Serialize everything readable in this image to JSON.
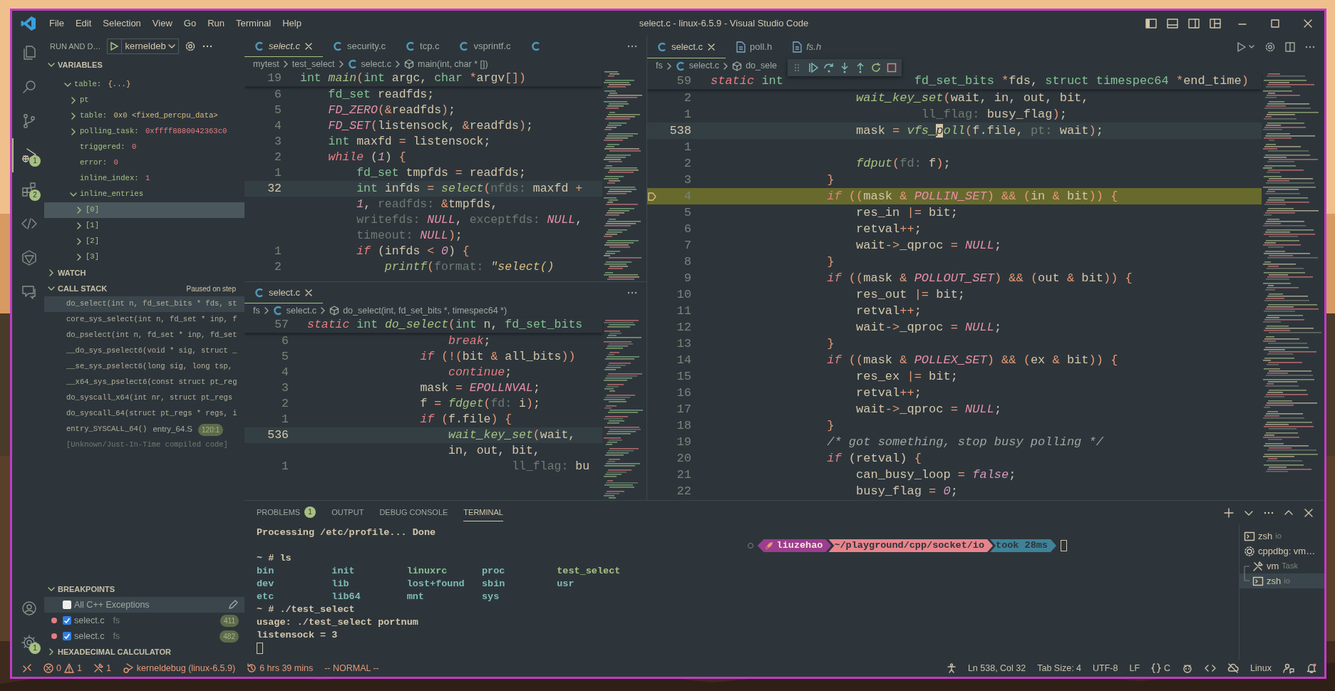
{
  "title_bar": {
    "menu": [
      "File",
      "Edit",
      "Selection",
      "View",
      "Go",
      "Run",
      "Terminal",
      "Help"
    ],
    "title": "select.c - linux-6.5.9 - Visual Studio Code"
  },
  "activity_bar": {
    "items": [
      {
        "selected": false
      },
      {
        "selected": false
      },
      {
        "selected": false
      },
      {
        "selected": true,
        "badge": "1"
      },
      {
        "selected": false,
        "badge": "2"
      },
      {
        "selected": false
      },
      {
        "selected": false
      },
      {
        "selected": false
      }
    ],
    "bottom": [
      {
        "selected": false
      },
      {
        "selected": false,
        "badge": "1"
      }
    ]
  },
  "sidebar": {
    "title": "RUN AND D…",
    "config": "kerneldeb",
    "sections": [
      {
        "kind": "variables",
        "title": "VARIABLES",
        "expanded": true,
        "tree": [
          {
            "name": "table:",
            "value": {
              "kind": "struct",
              "text": "{...}"
            },
            "kind": "group",
            "expanded": true,
            "selected": false,
            "children": [
              {
                "name": "pt",
                "kind": "group",
                "expanded": false,
                "selected": false
              },
              {
                "name": "table:",
                "value": {
                  "kind": "struct",
                  "text": "0x0 <fixed_percpu_data>"
                },
                "kind": "group",
                "expanded": false,
                "selected": false
              },
              {
                "name": "polling_task:",
                "value": {
                  "kind": "number",
                  "text": "0xffff8880042363c0"
                },
                "kind": "group",
                "expanded": false,
                "selected": false
              },
              {
                "name": "triggered:",
                "value": {
                  "kind": "number",
                  "text": "0"
                },
                "kind": "leaf",
                "selected": false
              },
              {
                "name": "error:",
                "value": {
                  "kind": "number",
                  "text": "0"
                },
                "kind": "leaf",
                "selected": false
              },
              {
                "name": "inline_index:",
                "value": {
                  "kind": "number",
                  "text": "1"
                },
                "kind": "leaf",
                "selected": false
              },
              {
                "name": "inline_entries",
                "kind": "group",
                "expanded": true,
                "selected": false,
                "children": [
                  {
                    "name": "[0]",
                    "kind": "group",
                    "expanded": false,
                    "selected": true
                  },
                  {
                    "name": "[1]",
                    "kind": "group",
                    "expanded": false,
                    "selected": false
                  },
                  {
                    "name": "[2]",
                    "kind": "group",
                    "expanded": false,
                    "selected": false
                  },
                  {
                    "name": "[3]",
                    "kind": "group",
                    "expanded": false,
                    "selected": false
                  }
                ]
              }
            ]
          }
        ]
      },
      {
        "kind": "watch",
        "title": "WATCH",
        "expanded": false
      },
      {
        "kind": "call_stack",
        "title": "CALL STACK",
        "expanded": true,
        "status": "Paused on step",
        "frames": [
          {
            "name": "do_select(int n, fd_set_bits * fds, st",
            "selected": true,
            "dimmed": false
          },
          {
            "name": "core_sys_select(int n, fd_set * inp, f",
            "selected": false,
            "dimmed": false
          },
          {
            "name": "do_pselect(int n, fd_set * inp, fd_set",
            "selected": false,
            "dimmed": false
          },
          {
            "name": "__do_sys_pselect6(void * sig, struct _",
            "selected": false,
            "dimmed": false
          },
          {
            "name": "__se_sys_pselect6(long sig, long tsp,",
            "selected": false,
            "dimmed": false
          },
          {
            "name": "__x64_sys_pselect6(const struct pt_reg",
            "selected": false,
            "dimmed": false
          },
          {
            "name": "do_syscall_x64(int nr, struct pt_regs",
            "selected": false,
            "dimmed": false
          },
          {
            "name": "do_syscall_64(struct pt_regs * regs, i",
            "selected": false,
            "dimmed": false
          },
          {
            "name": "entry_SYSCALL_64()",
            "file": "entry_64.S",
            "line": "120:1",
            "selected": false,
            "dimmed": false
          },
          {
            "name": "[Unknown/Just-In-Time compiled code]",
            "selected": false,
            "dimmed": true
          }
        ]
      },
      {
        "kind": "breakpoints",
        "title": "BREAKPOINTS",
        "expanded": true,
        "items": [
          {
            "kind": "exception",
            "label": "All C++ Exceptions",
            "checked": false,
            "selected": true
          },
          {
            "kind": "source",
            "label": "select.c",
            "path": "fs",
            "line": "411",
            "checked": true,
            "selected": false
          },
          {
            "kind": "source",
            "label": "select.c",
            "path": "fs",
            "line": "482",
            "checked": true,
            "selected": false
          }
        ]
      },
      {
        "kind": "hex",
        "title": "HEXADECIMAL CALCULATOR",
        "expanded": false
      }
    ]
  },
  "editors": [
    {
      "tabs": [
        {
          "kind": "source",
          "label": "select.c",
          "selected": true,
          "preview": true
        },
        {
          "kind": "source",
          "label": "security.c",
          "selected": false,
          "preview": false
        },
        {
          "kind": "source",
          "label": "tcp.c",
          "selected": false,
          "preview": false
        },
        {
          "kind": "source",
          "label": "vsprintf.c",
          "selected": false,
          "preview": false
        },
        {
          "kind": "source",
          "selected": false
        }
      ],
      "breadcrumb": [
        {
          "kind": "folder",
          "text": "mytest"
        },
        {
          "kind": "folder",
          "text": "test_select"
        },
        {
          "kind": "file",
          "text": "select.c"
        },
        {
          "kind": "symbol",
          "text": "main(int, char * [])"
        }
      ],
      "sticky": {
        "no": "19",
        "tokens": [
          {
            "kind": "type",
            "text": "int"
          },
          {
            "kind": "fn",
            "text": " main"
          },
          {
            "kind": "op",
            "text": "("
          },
          {
            "kind": "type",
            "text": "int"
          },
          {
            "kind": "plain",
            "text": " argc, "
          },
          {
            "kind": "type",
            "text": "char"
          },
          {
            "kind": "op",
            "text": " *"
          },
          {
            "kind": "plain",
            "text": "argv"
          },
          {
            "kind": "op",
            "text": "[])"
          }
        ]
      },
      "lines": [
        {
          "no": "6",
          "kind": "normal",
          "tokens": [
            {
              "kind": "type",
              "text": "    fd_set"
            },
            {
              "kind": "plain",
              "text": " readfds;"
            }
          ]
        },
        {
          "no": "5",
          "kind": "normal",
          "tokens": [
            {
              "kind": "macro",
              "text": "    FD_ZERO"
            },
            {
              "kind": "op",
              "text": "(&"
            },
            {
              "kind": "plain",
              "text": "readfds"
            },
            {
              "kind": "op",
              "text": ")"
            },
            {
              "kind": "plain",
              "text": ";"
            }
          ]
        },
        {
          "no": "4",
          "kind": "normal",
          "tokens": [
            {
              "kind": "macro",
              "text": "    FD_SET"
            },
            {
              "kind": "op",
              "text": "("
            },
            {
              "kind": "plain",
              "text": "listensock, "
            },
            {
              "kind": "op",
              "text": "&"
            },
            {
              "kind": "plain",
              "text": "readfds"
            },
            {
              "kind": "op",
              "text": ")"
            },
            {
              "kind": "plain",
              "text": ";"
            }
          ]
        },
        {
          "no": "3",
          "kind": "normal",
          "tokens": [
            {
              "kind": "type",
              "text": "    int"
            },
            {
              "kind": "plain",
              "text": " maxfd "
            },
            {
              "kind": "op",
              "text": "="
            },
            {
              "kind": "plain",
              "text": " listensock;"
            }
          ]
        },
        {
          "no": "2",
          "kind": "normal",
          "tokens": [
            {
              "kind": "kw",
              "text": "    while"
            },
            {
              "kind": "plain",
              "text": " ("
            },
            {
              "kind": "num",
              "text": "1"
            },
            {
              "kind": "plain",
              "text": ") "
            },
            {
              "kind": "op",
              "text": "{"
            }
          ]
        },
        {
          "no": "1",
          "kind": "normal",
          "tokens": [
            {
              "kind": "type",
              "text": "        fd_set"
            },
            {
              "kind": "plain",
              "text": " tmpfds "
            },
            {
              "kind": "op",
              "text": "="
            },
            {
              "kind": "plain",
              "text": " readfds;"
            }
          ]
        },
        {
          "no": "32",
          "kind": "current",
          "tokens": [
            {
              "kind": "type",
              "text": "        int"
            },
            {
              "kind": "plain",
              "text": " infds "
            },
            {
              "kind": "op",
              "text": "="
            },
            {
              "kind": "fn",
              "text": " select"
            },
            {
              "kind": "op",
              "text": "("
            },
            {
              "kind": "hint",
              "text": "nfds:"
            },
            {
              "kind": "plain",
              "text": " maxfd "
            },
            {
              "kind": "op",
              "text": "+"
            }
          ]
        },
        {
          "kind": "normal",
          "tokens": [
            {
              "kind": "num",
              "text": "        1"
            },
            {
              "kind": "plain",
              "text": ", "
            },
            {
              "kind": "hint",
              "text": "readfds:"
            },
            {
              "kind": "op",
              "text": " &"
            },
            {
              "kind": "plain",
              "text": "tmpfds,"
            }
          ]
        },
        {
          "kind": "normal",
          "tokens": [
            {
              "kind": "hint",
              "text": "        writefds:"
            },
            {
              "kind": "macro",
              "text": " NULL"
            },
            {
              "kind": "plain",
              "text": ", "
            },
            {
              "kind": "hint",
              "text": "exceptfds:"
            },
            {
              "kind": "macro",
              "text": " NULL"
            },
            {
              "kind": "plain",
              "text": ","
            }
          ]
        },
        {
          "kind": "normal",
          "tokens": [
            {
              "kind": "hint",
              "text": "        timeout:"
            },
            {
              "kind": "macro",
              "text": " NULL"
            },
            {
              "kind": "op",
              "text": ")"
            },
            {
              "kind": "plain",
              "text": ";"
            }
          ]
        },
        {
          "no": "1",
          "kind": "normal",
          "tokens": [
            {
              "kind": "kw",
              "text": "        if"
            },
            {
              "kind": "plain",
              "text": " (infds "
            },
            {
              "kind": "op",
              "text": "<"
            },
            {
              "kind": "num",
              "text": " 0"
            },
            {
              "kind": "plain",
              "text": ") "
            },
            {
              "kind": "op",
              "text": "{"
            }
          ]
        },
        {
          "no": "2",
          "kind": "normal",
          "tokens": [
            {
              "kind": "fn",
              "text": "            printf"
            },
            {
              "kind": "op",
              "text": "("
            },
            {
              "kind": "hint",
              "text": "format:"
            },
            {
              "kind": "str",
              "text": " \"select()"
            }
          ]
        }
      ]
    },
    {
      "tabs": [
        {
          "kind": "source",
          "label": "select.c",
          "selected": true,
          "preview": false
        }
      ],
      "breadcrumb": [
        {
          "kind": "folder",
          "text": "fs"
        },
        {
          "kind": "file",
          "text": "select.c"
        },
        {
          "kind": "symbol",
          "text": "do_select(int, fd_set_bits *, timespec64 *)"
        }
      ],
      "sticky": {
        "no": "57",
        "tokens": [
          {
            "kind": "kw",
            "text": "static"
          },
          {
            "kind": "type",
            "text": " int"
          },
          {
            "kind": "fn",
            "text": " do_select"
          },
          {
            "kind": "op",
            "text": "("
          },
          {
            "kind": "type",
            "text": "int"
          },
          {
            "kind": "plain",
            "text": " n, "
          },
          {
            "kind": "type",
            "text": "fd_set_bits"
          }
        ]
      },
      "lines": [
        {
          "no": "6",
          "kind": "normal",
          "tokens": [
            {
              "kind": "kw",
              "text": "                    break"
            },
            {
              "kind": "plain",
              "text": ";"
            }
          ]
        },
        {
          "no": "5",
          "kind": "normal",
          "tokens": [
            {
              "kind": "kw",
              "text": "                if"
            },
            {
              "kind": "op",
              "text": " (!("
            },
            {
              "kind": "plain",
              "text": "bit "
            },
            {
              "kind": "op",
              "text": "&"
            },
            {
              "kind": "plain",
              "text": " all_bits"
            },
            {
              "kind": "op",
              "text": "))"
            }
          ]
        },
        {
          "no": "4",
          "kind": "normal",
          "tokens": [
            {
              "kind": "kw",
              "text": "                    continue"
            },
            {
              "kind": "plain",
              "text": ";"
            }
          ]
        },
        {
          "no": "3",
          "kind": "normal",
          "tokens": [
            {
              "kind": "plain",
              "text": "                mask "
            },
            {
              "kind": "op",
              "text": "="
            },
            {
              "kind": "macro",
              "text": " EPOLLNVAL"
            },
            {
              "kind": "plain",
              "text": ";"
            }
          ]
        },
        {
          "no": "2",
          "kind": "normal",
          "tokens": [
            {
              "kind": "plain",
              "text": "                f "
            },
            {
              "kind": "op",
              "text": "="
            },
            {
              "kind": "fn",
              "text": " fdget"
            },
            {
              "kind": "op",
              "text": "("
            },
            {
              "kind": "hint",
              "text": "fd:"
            },
            {
              "kind": "plain",
              "text": " i"
            },
            {
              "kind": "op",
              "text": ")"
            },
            {
              "kind": "plain",
              "text": ";"
            }
          ]
        },
        {
          "no": "1",
          "kind": "normal",
          "tokens": [
            {
              "kind": "kw",
              "text": "                if"
            },
            {
              "kind": "op",
              "text": " ("
            },
            {
              "kind": "plain",
              "text": "f.file"
            },
            {
              "kind": "op",
              "text": ") {"
            }
          ]
        },
        {
          "no": "536",
          "kind": "current",
          "tokens": [
            {
              "kind": "fn",
              "text": "                    wait_key_set"
            },
            {
              "kind": "op",
              "text": "("
            },
            {
              "kind": "plain",
              "text": "wait,"
            }
          ]
        },
        {
          "kind": "normal",
          "tokens": [
            {
              "kind": "plain",
              "text": "                    in, out, bit,"
            }
          ]
        },
        {
          "no": "1",
          "kind": "normal",
          "tokens": [
            {
              "kind": "hint",
              "text": "                             ll_flag:"
            },
            {
              "kind": "plain",
              "text": " bu"
            }
          ]
        }
      ]
    },
    {
      "tabs": [
        {
          "kind": "source",
          "label": "select.c",
          "selected": true,
          "preview": false
        },
        {
          "kind": "header",
          "label": "poll.h",
          "selected": false,
          "preview": false
        },
        {
          "kind": "header",
          "label": "fs.h",
          "selected": false,
          "preview": true
        }
      ],
      "breadcrumb": [
        {
          "kind": "folder",
          "text": "fs"
        },
        {
          "kind": "file",
          "text": "select.c"
        },
        {
          "kind": "symbol",
          "text": "do_sele"
        }
      ],
      "sticky": {
        "no": "59",
        "tokens": [
          {
            "kind": "kw",
            "text": "static"
          },
          {
            "kind": "type",
            "text": " int"
          }
        ],
        "tail": [
          {
            "kind": "type",
            "text": "fd_set_bits"
          },
          {
            "kind": "op",
            "text": " *"
          },
          {
            "kind": "plain",
            "text": "fds, "
          },
          {
            "kind": "type",
            "text": "struct"
          },
          {
            "kind": "type",
            "text": " timespec64"
          },
          {
            "kind": "op",
            "text": " *"
          },
          {
            "kind": "plain",
            "text": "end_time"
          },
          {
            "kind": "op",
            "text": ")"
          }
        ]
      },
      "lines": [
        {
          "no": "2",
          "kind": "normal",
          "tokens": [
            {
              "kind": "fn",
              "text": "                    wait_key_set"
            },
            {
              "kind": "op",
              "text": "("
            },
            {
              "kind": "plain",
              "text": "wait, in, out, bit,"
            }
          ]
        },
        {
          "no": "1",
          "kind": "normal",
          "tokens": [
            {
              "kind": "hint",
              "text": "                             ll_flag:"
            },
            {
              "kind": "plain",
              "text": " busy_flag"
            },
            {
              "kind": "op",
              "text": ")"
            },
            {
              "kind": "plain",
              "text": ";"
            }
          ]
        },
        {
          "no": "538",
          "kind": "current",
          "tokens": [
            {
              "kind": "plain",
              "text": "                    mask "
            },
            {
              "kind": "op",
              "text": "="
            },
            {
              "kind": "fn",
              "text": " vfs_"
            },
            {
              "kind": "cursor",
              "text": "p"
            },
            {
              "kind": "fn",
              "text": "oll"
            },
            {
              "kind": "op",
              "text": "("
            },
            {
              "kind": "plain",
              "text": "f.file, "
            },
            {
              "kind": "hint",
              "text": "pt:"
            },
            {
              "kind": "plain",
              "text": " wait"
            },
            {
              "kind": "op",
              "text": ")"
            },
            {
              "kind": "plain",
              "text": ";"
            }
          ]
        },
        {
          "no": "1",
          "kind": "normal"
        },
        {
          "no": "2",
          "kind": "normal",
          "tokens": [
            {
              "kind": "fn",
              "text": "                    fdput"
            },
            {
              "kind": "op",
              "text": "("
            },
            {
              "kind": "hint",
              "text": "fd:"
            },
            {
              "kind": "plain",
              "text": " f"
            },
            {
              "kind": "op",
              "text": ")"
            },
            {
              "kind": "plain",
              "text": ";"
            }
          ]
        },
        {
          "no": "3",
          "kind": "normal",
          "tokens": [
            {
              "kind": "op",
              "text": "                }"
            }
          ]
        },
        {
          "no": "4",
          "kind": "stopped",
          "tokens": [
            {
              "kind": "kw",
              "text": "                if"
            },
            {
              "kind": "op",
              "text": " (("
            },
            {
              "kind": "plain",
              "text": "mask "
            },
            {
              "kind": "op",
              "text": "&"
            },
            {
              "kind": "macro",
              "text": " POLLIN_SET"
            },
            {
              "kind": "op",
              "text": ") && ("
            },
            {
              "kind": "plain",
              "text": "in "
            },
            {
              "kind": "op",
              "text": "&"
            },
            {
              "kind": "plain",
              "text": " bit"
            },
            {
              "kind": "op",
              "text": ")) {"
            }
          ]
        },
        {
          "no": "5",
          "kind": "normal",
          "tokens": [
            {
              "kind": "plain",
              "text": "                    res_in "
            },
            {
              "kind": "op",
              "text": "|="
            },
            {
              "kind": "plain",
              "text": " bit;"
            }
          ]
        },
        {
          "no": "6",
          "kind": "normal",
          "tokens": [
            {
              "kind": "plain",
              "text": "                    retval"
            },
            {
              "kind": "op",
              "text": "++"
            },
            {
              "kind": "plain",
              "text": ";"
            }
          ]
        },
        {
          "no": "7",
          "kind": "normal",
          "tokens": [
            {
              "kind": "plain",
              "text": "                    wait"
            },
            {
              "kind": "op",
              "text": "->"
            },
            {
              "kind": "plain",
              "text": "_qproc "
            },
            {
              "kind": "op",
              "text": "="
            },
            {
              "kind": "macro",
              "text": " NULL"
            },
            {
              "kind": "plain",
              "text": ";"
            }
          ]
        },
        {
          "no": "8",
          "kind": "normal",
          "tokens": [
            {
              "kind": "op",
              "text": "                }"
            }
          ]
        },
        {
          "no": "9",
          "kind": "normal",
          "tokens": [
            {
              "kind": "kw",
              "text": "                if"
            },
            {
              "kind": "op",
              "text": " (("
            },
            {
              "kind": "plain",
              "text": "mask "
            },
            {
              "kind": "op",
              "text": "&"
            },
            {
              "kind": "macro",
              "text": " POLLOUT_SET"
            },
            {
              "kind": "op",
              "text": ") && ("
            },
            {
              "kind": "plain",
              "text": "out "
            },
            {
              "kind": "op",
              "text": "&"
            },
            {
              "kind": "plain",
              "text": " bit"
            },
            {
              "kind": "op",
              "text": ")) {"
            }
          ]
        },
        {
          "no": "10",
          "kind": "normal",
          "tokens": [
            {
              "kind": "plain",
              "text": "                    res_out "
            },
            {
              "kind": "op",
              "text": "|="
            },
            {
              "kind": "plain",
              "text": " bit;"
            }
          ]
        },
        {
          "no": "11",
          "kind": "normal",
          "tokens": [
            {
              "kind": "plain",
              "text": "                    retval"
            },
            {
              "kind": "op",
              "text": "++"
            },
            {
              "kind": "plain",
              "text": ";"
            }
          ]
        },
        {
          "no": "12",
          "kind": "normal",
          "tokens": [
            {
              "kind": "plain",
              "text": "                    wait"
            },
            {
              "kind": "op",
              "text": "->"
            },
            {
              "kind": "plain",
              "text": "_qproc "
            },
            {
              "kind": "op",
              "text": "="
            },
            {
              "kind": "macro",
              "text": " NULL"
            },
            {
              "kind": "plain",
              "text": ";"
            }
          ]
        },
        {
          "no": "13",
          "kind": "normal",
          "tokens": [
            {
              "kind": "op",
              "text": "                }"
            }
          ]
        },
        {
          "no": "14",
          "kind": "normal",
          "tokens": [
            {
              "kind": "kw",
              "text": "                if"
            },
            {
              "kind": "op",
              "text": " (("
            },
            {
              "kind": "plain",
              "text": "mask "
            },
            {
              "kind": "op",
              "text": "&"
            },
            {
              "kind": "macro",
              "text": " POLLEX_SET"
            },
            {
              "kind": "op",
              "text": ") && ("
            },
            {
              "kind": "plain",
              "text": "ex "
            },
            {
              "kind": "op",
              "text": "&"
            },
            {
              "kind": "plain",
              "text": " bit"
            },
            {
              "kind": "op",
              "text": ")) {"
            }
          ]
        },
        {
          "no": "15",
          "kind": "normal",
          "tokens": [
            {
              "kind": "plain",
              "text": "                    res_ex "
            },
            {
              "kind": "op",
              "text": "|="
            },
            {
              "kind": "plain",
              "text": " bit;"
            }
          ]
        },
        {
          "no": "16",
          "kind": "normal",
          "tokens": [
            {
              "kind": "plain",
              "text": "                    retval"
            },
            {
              "kind": "op",
              "text": "++"
            },
            {
              "kind": "plain",
              "text": ";"
            }
          ]
        },
        {
          "no": "17",
          "kind": "normal",
          "tokens": [
            {
              "kind": "plain",
              "text": "                    wait"
            },
            {
              "kind": "op",
              "text": "->"
            },
            {
              "kind": "plain",
              "text": "_qproc "
            },
            {
              "kind": "op",
              "text": "="
            },
            {
              "kind": "macro",
              "text": " NULL"
            },
            {
              "kind": "plain",
              "text": ";"
            }
          ]
        },
        {
          "no": "18",
          "kind": "normal",
          "tokens": [
            {
              "kind": "op",
              "text": "                }"
            }
          ]
        },
        {
          "no": "19",
          "kind": "normal",
          "tokens": [
            {
              "kind": "comment",
              "text": "                /* got something, stop busy polling */"
            }
          ]
        },
        {
          "no": "20",
          "kind": "normal",
          "tokens": [
            {
              "kind": "kw",
              "text": "                if"
            },
            {
              "kind": "plain",
              "text": " (retval) "
            },
            {
              "kind": "op",
              "text": "{"
            }
          ]
        },
        {
          "no": "21",
          "kind": "normal",
          "tokens": [
            {
              "kind": "plain",
              "text": "                    can_busy_loop "
            },
            {
              "kind": "op",
              "text": "="
            },
            {
              "kind": "num",
              "text": " false"
            },
            {
              "kind": "plain",
              "text": ";"
            }
          ]
        },
        {
          "no": "22",
          "kind": "normal",
          "tokens": [
            {
              "kind": "plain",
              "text": "                    busy_flag "
            },
            {
              "kind": "op",
              "text": "="
            },
            {
              "kind": "num",
              "text": " 0"
            },
            {
              "kind": "plain",
              "text": ";"
            }
          ]
        }
      ]
    }
  ],
  "panel": {
    "tabs": [
      {
        "label": "PROBLEMS",
        "badge": "1",
        "selected": false
      },
      {
        "label": "OUTPUT",
        "selected": false
      },
      {
        "label": "DEBUG CONSOLE",
        "selected": false
      },
      {
        "label": "TERMINAL",
        "selected": true
      }
    ],
    "terminal": [
      {
        "kind": "text",
        "text": "Processing /etc/profile... Done"
      },
      {
        "kind": "rprompt",
        "segments": [
          {
            "text": "liuzehao",
            "color": "#9c3d8f"
          },
          {
            "text": "~/playground/cpp/socket/io",
            "color": "#e7848c"
          },
          {
            "text": "took 28ms",
            "color": "#3f8298"
          }
        ]
      },
      {
        "kind": "text",
        "text": "~ # ls"
      },
      {
        "kind": "ls",
        "rows": [
          [
            {
              "text": "bin",
              "kind": "dir"
            },
            {
              "text": "init",
              "kind": "dir"
            },
            {
              "text": "linuxrc",
              "kind": "link"
            },
            {
              "text": "proc",
              "kind": "dir"
            },
            {
              "text": "test_select",
              "kind": "exe"
            }
          ],
          [
            {
              "text": "dev",
              "kind": "dir"
            },
            {
              "text": "lib",
              "kind": "dir"
            },
            {
              "text": "lost+found",
              "kind": "dir"
            },
            {
              "text": "sbin",
              "kind": "dir"
            },
            {
              "text": "usr",
              "kind": "dir"
            }
          ],
          [
            {
              "text": "etc",
              "kind": "dir"
            },
            {
              "text": "lib64",
              "kind": "dir"
            },
            {
              "text": "mnt",
              "kind": "dir"
            },
            {
              "text": "sys",
              "kind": "dir"
            }
          ]
        ]
      },
      {
        "kind": "text",
        "text": "~ # ./test_select"
      },
      {
        "kind": "text",
        "text": "usage: ./test_select portnum"
      },
      {
        "kind": "text",
        "text": "listensock = 3"
      },
      {
        "kind": "cursor"
      }
    ],
    "terminal_list": [
      {
        "name": "zsh",
        "detail": "io",
        "kind": "terminal",
        "selected": false,
        "split": false
      },
      {
        "name": "cppdbg: vm…",
        "kind": "debug",
        "selected": false,
        "split": false
      },
      {
        "name": "vm",
        "detail": "Task",
        "kind": "task",
        "selected": false,
        "split": true
      },
      {
        "name": "zsh",
        "detail": "io",
        "kind": "terminal",
        "selected": true,
        "split": true
      }
    ]
  },
  "status_bar": {
    "errors": "0",
    "warnings": "1",
    "ports": "1",
    "debug": "kerneldebug (linux-6.5.9)",
    "timer": "6 hrs 39 mins",
    "mode": "-- NORMAL --",
    "right": [
      "Ln 538, Col 32",
      "Tab Size: 4",
      "UTF-8",
      "LF",
      "C",
      "Linux"
    ]
  }
}
